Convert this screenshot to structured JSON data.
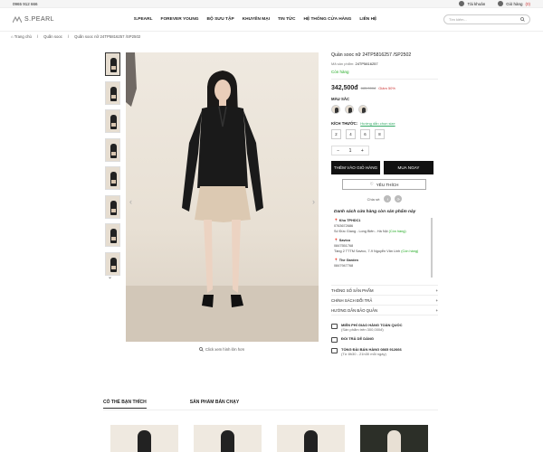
{
  "topbar": {
    "phone": "0965 912 666",
    "login": "Tài khoản",
    "cart_label": "Giỏ hàng",
    "cart_count": "(0)"
  },
  "header": {
    "logo": "S.PEARL",
    "nav": [
      "S.PEARL",
      "FOREVER YOUNG",
      "BỘ SƯU TẬP",
      "KHUYẾN MẠI",
      "TIN TỨC",
      "HỆ THỐNG CỬA HÀNG",
      "LIÊN HỆ"
    ],
    "search_placeholder": "Tìm kiếm..."
  },
  "breadcrumb": [
    "Trang chủ",
    "Quần sooc",
    "Quần sooc nữ 24TP5816257 /SP2502"
  ],
  "gallery": {
    "zoom_hint": "Click xem hình lớn hơn",
    "thumb_count": 8
  },
  "product": {
    "title": "Quần sooc nữ 24TP5816257 /SP2502",
    "sku_label": "Mã sản phẩm:",
    "sku": "24TP5816257",
    "stock": "Còn hàng",
    "price": "342,500đ",
    "old_price": "685,000đ",
    "discount": "Giảm 50%",
    "color_label": "MÀU SẮC",
    "size_label": "KÍCH THƯỚC:",
    "size_guide": "Hướng dẫn chọn size",
    "sizes": [
      "2",
      "4",
      "6",
      "8"
    ],
    "qty": {
      "minus": "−",
      "value": "1",
      "plus": "+"
    },
    "add_to_cart": "THÊM VÀO GIỎ HÀNG",
    "buy_now": "MUA NGAY",
    "like": "YÊU THÍCH",
    "share_label": "Chia sẻ:"
  },
  "stores": {
    "title": "Danh sách cửa hàng còn sản phẩm này",
    "items": [
      {
        "name": "Kho TPHDC1",
        "phone": "0763672686",
        "address": "Số Đức Giang - Long Biên - Hà Nội",
        "status": "(Còn hàng)"
      },
      {
        "name": "Savico",
        "phone": "0847551768",
        "address": "Tầng 2 TTTM Savico, 7-9 Nguyễn Văn Linh",
        "status": "(Còn hàng)"
      },
      {
        "name": "The Garden",
        "phone": "0847947768",
        "address": "",
        "status": ""
      }
    ]
  },
  "accordion": [
    "THÔNG SỐ SẢN PHẨM",
    "CHÍNH SÁCH ĐỔI TRẢ",
    "HƯỚNG DẪN BẢO QUẢN"
  ],
  "perks": [
    {
      "title": "MIỄN PHÍ GIAO HÀNG TOÀN QUỐC",
      "sub": "(Sản phẩm trên 300,000đ)"
    },
    {
      "title": "ĐỔI TRẢ DỄ DÀNG",
      "sub": ""
    },
    {
      "title": "TỔNG ĐÀI BÁN HÀNG 0865 912666",
      "sub": "(Từ 8h30 - 21h30 mỗi ngày)"
    }
  ],
  "bottom_tabs": [
    "CÓ THỂ BẠN THÍCH",
    "SẢN PHẨM BÁN CHẠY"
  ]
}
